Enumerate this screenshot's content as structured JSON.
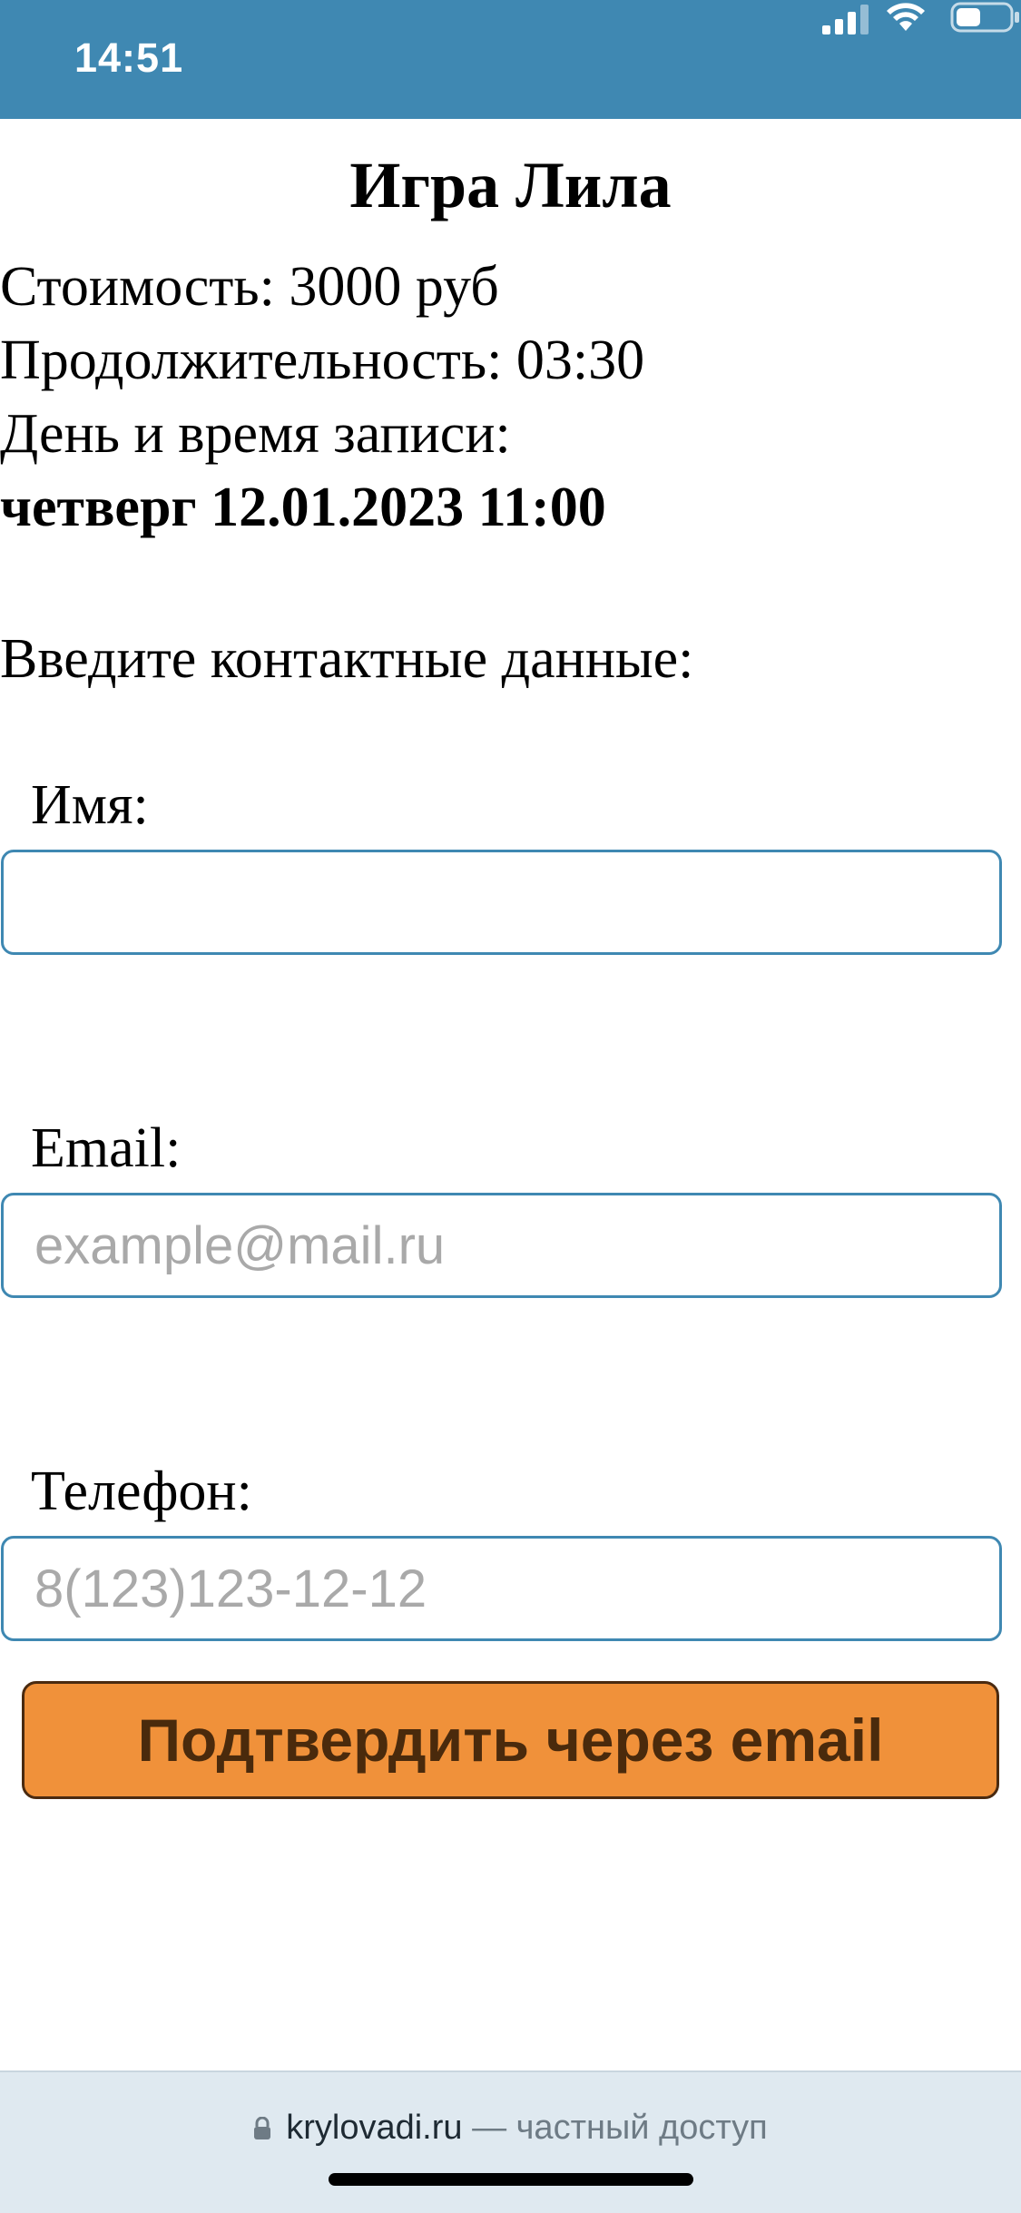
{
  "status_bar": {
    "time": "14:51",
    "background": "#3f88b2"
  },
  "page": {
    "title": "Игра Лила",
    "cost": "Стоимость: 3000 руб",
    "duration": "Продолжительность: 03:30",
    "booking_label": "День и время записи:",
    "booking_value": "четверг 12.01.2023 11:00",
    "prompt": "Введите контактные данные:"
  },
  "form": {
    "name": {
      "label": "Имя:",
      "value": "",
      "placeholder": ""
    },
    "email": {
      "label": "Email:",
      "value": "",
      "placeholder": "example@mail.ru"
    },
    "phone": {
      "label": "Телефон:",
      "value": "",
      "placeholder": "8(123)123-12-12"
    },
    "confirm_label": "Подтвердить через email"
  },
  "browser": {
    "domain": "krylovadi.ru",
    "suffix": " — частный доступ"
  },
  "colors": {
    "accent": "#3f88b2",
    "button": "#f0913a",
    "button_text": "#4a2a0c"
  },
  "icons": [
    "signal-icon",
    "wifi-icon",
    "battery-icon",
    "lock-icon"
  ]
}
